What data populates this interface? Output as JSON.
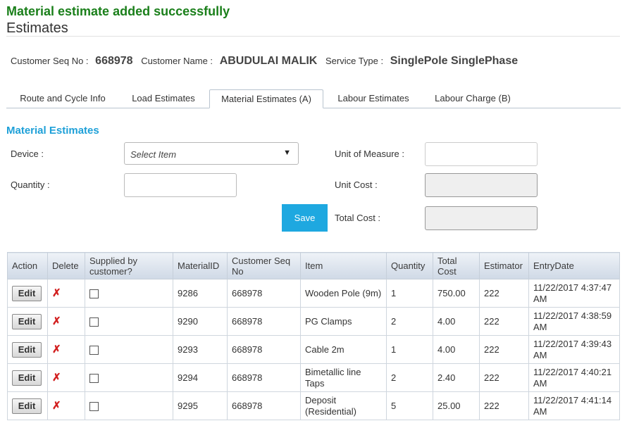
{
  "message": "Material estimate added successfully",
  "page_title": "Estimates",
  "customer": {
    "seq_label": "Customer Seq No :",
    "seq_value": "668978",
    "name_label": "Customer Name :",
    "name_value": "ABUDULAI MALIK",
    "service_label": "Service Type :",
    "service_value": "SinglePole SinglePhase"
  },
  "tabs": [
    {
      "label": "Route and Cycle Info"
    },
    {
      "label": "Load Estimates"
    },
    {
      "label": "Material Estimates (A)"
    },
    {
      "label": "Labour Estimates"
    },
    {
      "label": "Labour Charge (B)"
    }
  ],
  "section_title": "Material Estimates",
  "form": {
    "device_label": "Device :",
    "device_value": "Select Item",
    "quantity_label": "Quantity :",
    "uom_label": "Unit of Measure :",
    "unit_cost_label": "Unit Cost :",
    "total_cost_label": "Total Cost :",
    "save_label": "Save"
  },
  "table": {
    "headers": [
      "Action",
      "Delete",
      "Supplied by customer?",
      "MaterialID",
      "Customer Seq No",
      "Item",
      "Quantity",
      "Total Cost",
      "Estimator",
      "EntryDate"
    ],
    "edit_label": "Edit",
    "delete_glyph": "✗",
    "rows": [
      {
        "material_id": "9286",
        "seq": "668978",
        "item": "Wooden Pole (9m)",
        "quantity": "1",
        "total_cost": "750.00",
        "estimator": "222",
        "entry_date": "11/22/2017 4:37:47 AM"
      },
      {
        "material_id": "9290",
        "seq": "668978",
        "item": "PG Clamps",
        "quantity": "2",
        "total_cost": "4.00",
        "estimator": "222",
        "entry_date": "11/22/2017 4:38:59 AM"
      },
      {
        "material_id": "9293",
        "seq": "668978",
        "item": "Cable 2m",
        "quantity": "1",
        "total_cost": "4.00",
        "estimator": "222",
        "entry_date": "11/22/2017 4:39:43 AM"
      },
      {
        "material_id": "9294",
        "seq": "668978",
        "item": "Bimetallic line Taps",
        "quantity": "2",
        "total_cost": "2.40",
        "estimator": "222",
        "entry_date": "11/22/2017 4:40:21 AM"
      },
      {
        "material_id": "9295",
        "seq": "668978",
        "item": "Deposit (Residential)",
        "quantity": "5",
        "total_cost": "25.00",
        "estimator": "222",
        "entry_date": "11/22/2017 4:41:14 AM"
      }
    ]
  },
  "colors": {
    "success": "#1a7f1a",
    "accent": "#1ea0d8",
    "button": "#1ea8e0",
    "delete": "#d21f1f"
  }
}
